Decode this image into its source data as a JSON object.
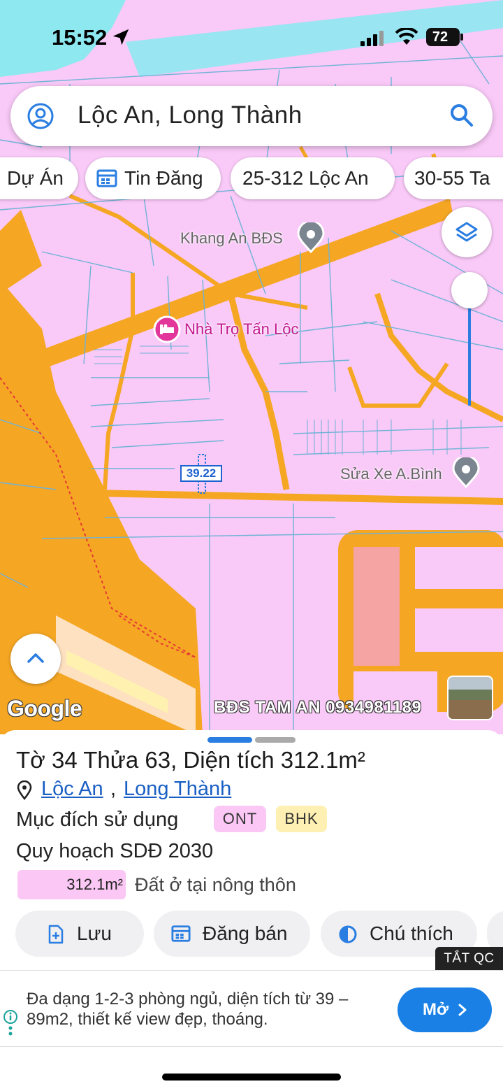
{
  "status_bar": {
    "time": "15:52",
    "battery": "72"
  },
  "search": {
    "query": "Lộc An, Long Thành"
  },
  "filter_chips": [
    {
      "label": "Dự Án"
    },
    {
      "label": "Tin Đăng",
      "icon": "calendar-icon"
    },
    {
      "label": "25-312 Lộc An"
    },
    {
      "label": "30-55 Ta"
    }
  ],
  "map": {
    "pois": {
      "khang_an": "Khang An BĐS",
      "nha_tro": "Nhà Trọ Tấn Lộc",
      "sua_xe": "Sửa Xe A.Bình"
    },
    "parcel_label": "39.22",
    "google_logo": "Google",
    "watermark": "BĐS TAM AN 0934981189",
    "colors": {
      "residential": "#f9c9f7",
      "road": "#f5a623",
      "pond": "#8ee8f0",
      "parcel_line": "#6fb3d6",
      "selected": "#2a7de1"
    }
  },
  "sheet": {
    "title": "Tờ 34 Thửa 63, Diện tích 312.1m²",
    "location": {
      "commune": "Lộc An",
      "separator": ",",
      "district": "Long Thành"
    },
    "purpose_label": "Mục đích sử dụng",
    "purpose_tags": [
      "ONT",
      "BHK"
    ],
    "plan_label": "Quy hoạch SDĐ 2030",
    "area_value": "312.1m²",
    "area_description": "Đất ở tại nông thôn",
    "actions": {
      "save": "Lưu",
      "sell": "Đăng bán",
      "legend": "Chú thích"
    }
  },
  "ad": {
    "close_label": "TẮT QC",
    "text": "Đa dạng 1-2-3 phòng ngủ, diện tích từ 39 – 89m2, thiết kế view đẹp, thoáng.",
    "button": "Mở"
  }
}
